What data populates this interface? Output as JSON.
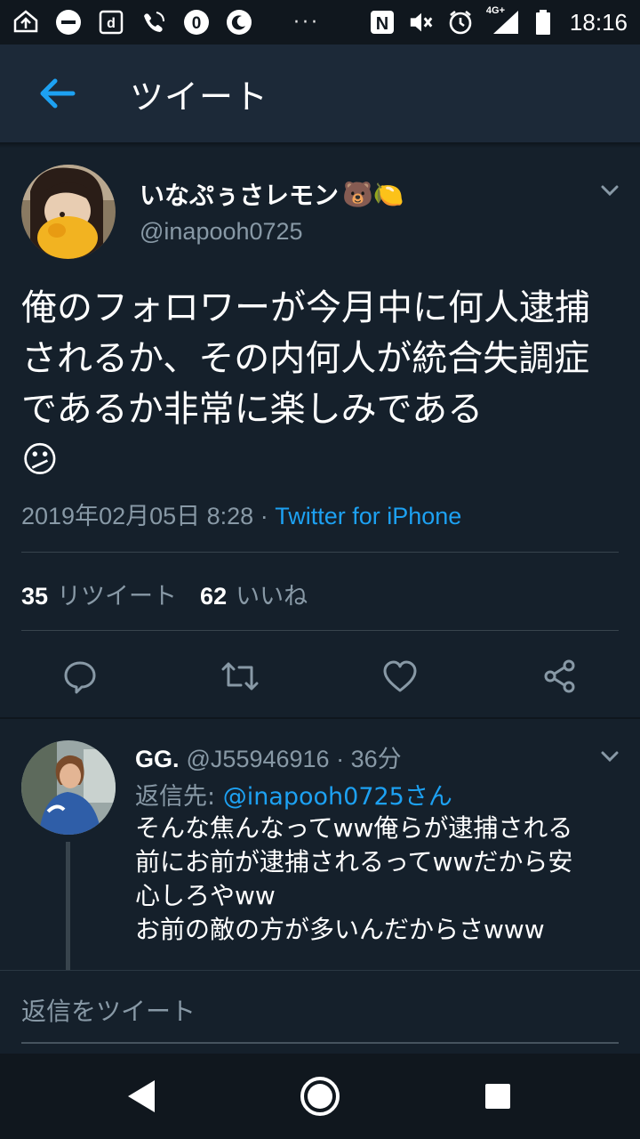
{
  "status_bar": {
    "time": "18:16",
    "network": "4G+",
    "nfc_label": "N",
    "badge_zero": "0",
    "overflow": "···",
    "icons": [
      "nav-map-icon",
      "do-not-disturb-icon",
      "docomo-d-icon",
      "call-on-icon",
      "zero-badge-icon",
      "night-moon-icon",
      "nfc-icon",
      "mute-icon",
      "alarm-icon",
      "signal-icon",
      "battery-icon"
    ]
  },
  "app_bar": {
    "title": "ツイート",
    "back_icon": "arrow-left-icon"
  },
  "tweet": {
    "author_name": "いなぷぅさレモン",
    "author_emoji": "🐻🍋",
    "author_handle": "@inapooh0725",
    "text": "俺のフォロワーが今月中に何人逮捕されるか、その内何人が統合失調症であるか非常に楽しみである",
    "text_emoji": "😕",
    "date": "2019年02月05日 8:28",
    "separator": " · ",
    "source": "Twitter for iPhone",
    "retweet_count": "35",
    "retweet_label": "リツイート",
    "like_count": "62",
    "like_label": "いいね",
    "actions": [
      "reply-icon",
      "retweet-icon",
      "like-icon",
      "share-icon"
    ]
  },
  "reply": {
    "name": "GG.",
    "handle": "@J55946916",
    "separator": " · ",
    "time": "36分",
    "reply_to_label": "返信先: ",
    "reply_to_handle": "@inapooh0725さん",
    "lines": [
      "そんな焦んなってww俺らが逮捕される",
      "前にお前が逮捕されるってwwだから安",
      "心しろやww",
      "お前の敵の方が多いんだからさwww"
    ]
  },
  "compose": {
    "placeholder": "返信をツイート"
  },
  "nav_bar": {
    "buttons": [
      "back-triangle-icon",
      "home-circle-icon",
      "recents-square-icon"
    ]
  },
  "colors": {
    "background": "#15202b",
    "app_bar": "#1c2938",
    "accent": "#1da1f2",
    "secondary_text": "#8899a6",
    "divider": "#38444d"
  }
}
